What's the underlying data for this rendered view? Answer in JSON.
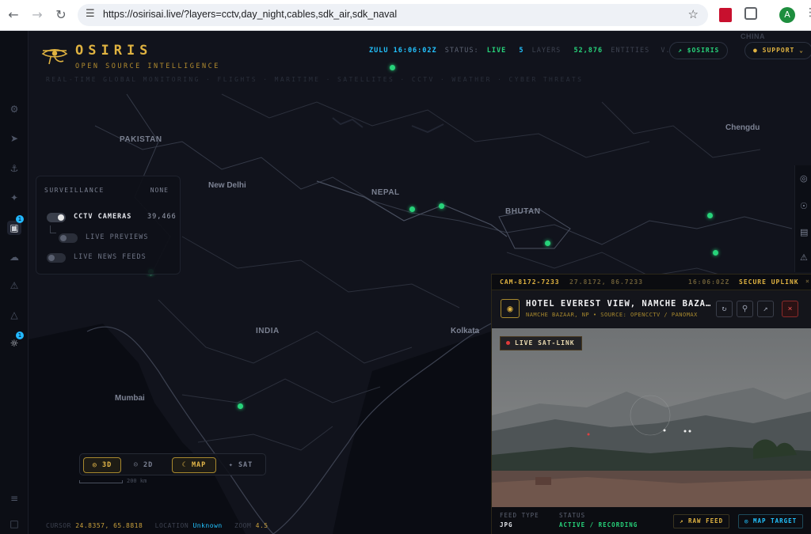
{
  "browser": {
    "url": "https://osirisai.live/?layers=cctv,day_night,cables,sdk_air,sdk_naval",
    "profile_initial": "A"
  },
  "header": {
    "brand": "OSIRIS",
    "brand_sub": "OPEN SOURCE INTELLIGENCE",
    "tagline": "REAL-TIME GLOBAL MONITORING · FLIGHTS · MARITIME · SATELLITES · CCTV · WEATHER · CYBER THREATS",
    "zulu": "ZULU 16:06:02Z",
    "status_label": "STATUS:",
    "status_value": "LIVE",
    "layers_count": "5",
    "layers_label": "LAYERS",
    "entities_count": "52,876",
    "entities_label": "ENTITIES",
    "version": "V.4.1",
    "token_button": "$OSIRIS",
    "support_button": "SUPPORT"
  },
  "map_labels": {
    "pakistan": "PAKISTAN",
    "new_delhi": "New Delhi",
    "nepal": "NEPAL",
    "bhutan": "BHUTAN",
    "india": "INDIA",
    "kolkata": "Kolkata",
    "mumbai": "Mumbai",
    "chengdu": "Chengdu",
    "china": "CHINA"
  },
  "surveillance": {
    "title": "SURVEILLANCE",
    "none_label": "NONE",
    "cctv_label": "CCTV CAMERAS",
    "cctv_count": "39,466",
    "cctv_enabled": true,
    "live_previews_label": "LIVE PREVIEWS",
    "live_previews_enabled": false,
    "news_feeds_label": "LIVE NEWS FEEDS",
    "news_feeds_enabled": false
  },
  "sidebar": {
    "badge_cctv": "1",
    "badge_settings": "1"
  },
  "view_controls": {
    "btn_3d": "3D",
    "btn_2d": "2D",
    "btn_map": "MAP",
    "btn_sat": "SAT",
    "scale": "200 km"
  },
  "cursor_bar": {
    "cursor_label": "CURSOR",
    "cursor_value": "24.8357, 65.8818",
    "location_label": "LOCATION",
    "location_value": "Unknown",
    "zoom_label": "ZOOM",
    "zoom_value": "4.5"
  },
  "cctv_panel": {
    "cam_id": "CAM-8172-7233",
    "coords": "27.8172, 86.7233",
    "time": "16:06:02Z",
    "uplink": "SECURE UPLINK",
    "title": "HOTEL EVEREST VIEW, NAMCHE BAZA…",
    "subtitle": "NAMCHE BAZAAR, NP • SOURCE: OPENCCTV / PANOMAX",
    "live_badge": "LIVE SAT-LINK",
    "feed_type_label": "FEED TYPE",
    "feed_type_value": "JPG",
    "status_label": "STATUS",
    "status_value": "ACTIVE / RECORDING",
    "raw_feed_button": "RAW FEED",
    "map_target_button": "MAP TARGET"
  },
  "colors": {
    "accent_gold": "#e0b341",
    "accent_cyan": "#22c3ff",
    "live_green": "#27d37a"
  }
}
